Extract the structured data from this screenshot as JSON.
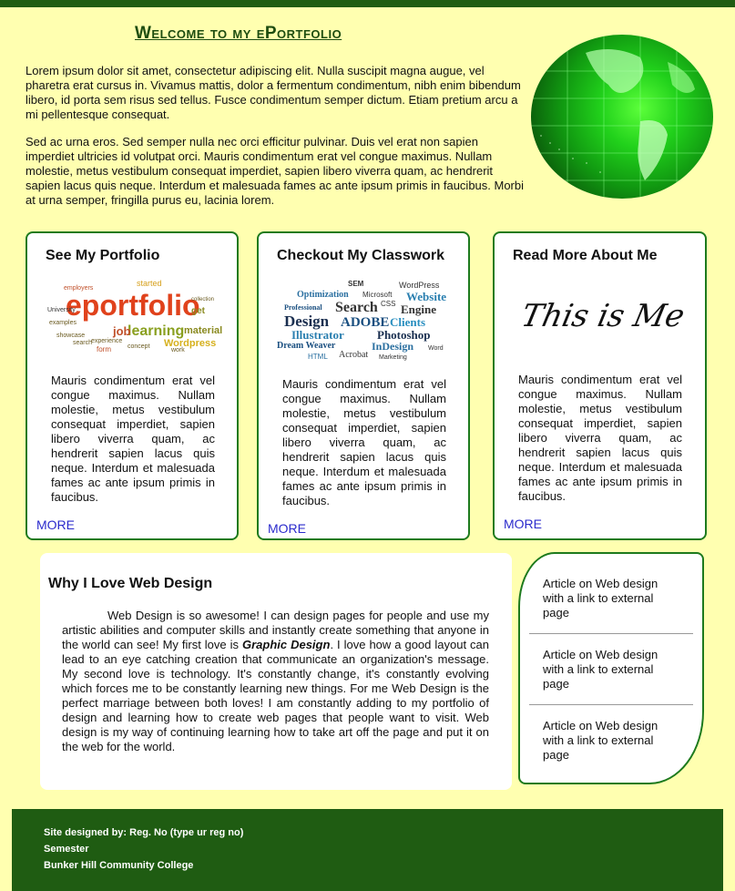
{
  "page": {
    "title": "Welcome to my ePortfolio",
    "intro_p1": "Lorem ipsum dolor sit amet, consectetur adipiscing elit. Nulla suscipit magna augue, vel pharetra erat cursus in. Vivamus mattis, dolor a fermentum condimentum, nibh enim bibendum libero, id porta sem risus sed tellus. Fusce condimentum semper dictum. Etiam pretium arcu a mi pellentesque consequat.",
    "intro_p2": "Sed ac urna eros. Sed semper nulla nec orci efficitur pulvinar. Duis vel erat non sapien imperdiet ultricies id volutpat orci. Mauris condimentum erat vel congue maximus. Nullam molestie, metus vestibulum consequat imperdiet, sapien libero viverra quam, ac hendrerit sapien lacus quis neque. Interdum et malesuada fames ac ante ipsum primis in faucibus. Morbi at urna semper, fringilla purus eu, lacinia lorem."
  },
  "cards": [
    {
      "heading": "See My Portfolio",
      "body": "Mauris condimentum erat vel congue maximus. Nullam molestie, metus vestibulum consequat imperdiet, sapien libero viverra quam, ac hendrerit sapien lacus quis neque. Interdum et malesuada fames ac ante ipsum primis in faucibus.",
      "more": "MORE",
      "cloud_main": "eportfolio",
      "cloud_words": [
        "learning",
        "material",
        "job",
        "Wordpress",
        "started",
        "employers",
        "work",
        "examples",
        "showcase",
        "search",
        "form",
        "concept",
        "experience",
        "collection",
        "University",
        "get"
      ]
    },
    {
      "heading": "Checkout My Classwork",
      "body": "Mauris condimentum erat vel congue maximus. Nullam molestie, metus vestibulum consequat imperdiet, sapien libero viverra quam, ac hendrerit sapien lacus quis neque. Interdum et malesuada fames ac ante ipsum primis in faucibus.",
      "more": "MORE",
      "cloud_words": [
        "SEM",
        "WordPress",
        "Optimization",
        "Website",
        "Professional",
        "Search",
        "Engine",
        "Design",
        "ADOBE",
        "Clients",
        "Illustrator",
        "Photoshop",
        "Dream Weaver",
        "InDesign",
        "Acrobat",
        "Marketing",
        "HTML",
        "CSS",
        "Microsoft",
        "Word"
      ]
    },
    {
      "heading": "Read More About Me",
      "body": "Mauris condimentum erat vel congue maximus. Nullam molestie, metus vestibulum consequat imperdiet, sapien libero viverra quam, ac hendrerit sapien lacus quis neque. Interdum et malesuada fames ac ante ipsum primis in faucibus.",
      "more": "MORE",
      "image_text": "This is Me"
    }
  ],
  "about": {
    "heading": "Why I Love Web Design",
    "text_before": "Web Design is so awesome! I can design pages for people and use my artistic abilities and computer skills and instantly create something that anyone in the world can see! My first love is ",
    "emphasis": "Graphic Design",
    "text_after": ". I love how a good layout can lead to an eye catching creation that communicate an organization's message. My second love is technology. It's constantly change, it's constantly evolving which forces me to be constantly learning new things. For me Web Design is the perfect marriage between both loves! I am constantly adding to my portfolio of design and learning how to create web pages that people want to visit. Web design is my way of continuing learning how to take art off the page and put it on the web for the world."
  },
  "articles": [
    "Article on Web design with a link to external page",
    "Article on Web design with a link to external page",
    "Article on Web design with a link to external page"
  ],
  "footer": {
    "line1": "Site designed by: Reg. No (type ur reg no)",
    "line2": "Semester",
    "line3": "Bunker Hill Community College"
  },
  "colors": {
    "background": "#ffffb0",
    "dark_green": "#1f5c12",
    "border_green": "#1d7a1d",
    "link_blue": "#2b2bcc"
  }
}
